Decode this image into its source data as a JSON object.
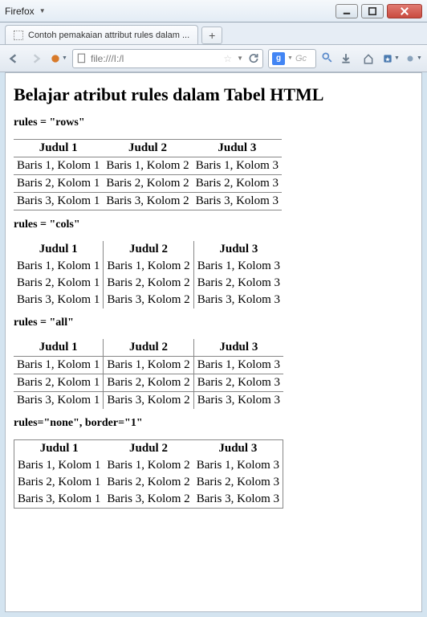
{
  "window": {
    "app_name": "Firefox",
    "tab_title": "Contoh pemakaian attribut rules dalam ...",
    "url_display": "file:///I:/l"
  },
  "search": {
    "placeholder": "Gc"
  },
  "page": {
    "heading": "Belajar atribut rules dalam Tabel HTML",
    "sections": [
      {
        "caption": "rules = \"rows\""
      },
      {
        "caption": "rules = \"cols\""
      },
      {
        "caption": "rules = \"all\""
      },
      {
        "caption": "rules=\"none\", border=\"1\""
      }
    ],
    "headers": [
      "Judul 1",
      "Judul 2",
      "Judul 3"
    ],
    "rows": [
      [
        "Baris 1, Kolom 1",
        "Baris 1, Kolom 2",
        "Baris 1, Kolom 3"
      ],
      [
        "Baris 2, Kolom 1",
        "Baris 2, Kolom 2",
        "Baris 2, Kolom 3"
      ],
      [
        "Baris 3, Kolom 1",
        "Baris 3, Kolom 2",
        "Baris 3, Kolom 3"
      ]
    ]
  }
}
